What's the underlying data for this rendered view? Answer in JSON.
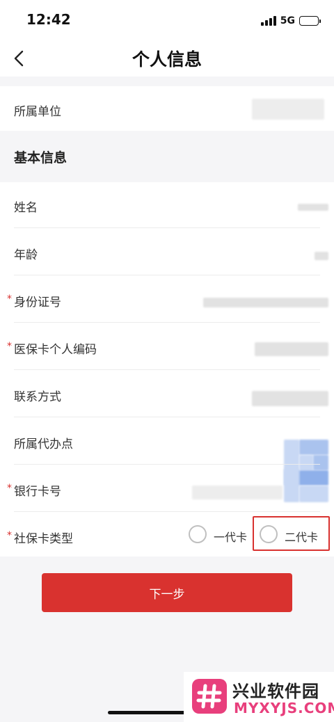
{
  "status_bar": {
    "time": "12:42",
    "network": "5G"
  },
  "nav": {
    "title": "个人信息",
    "back_icon": "chevron-left-icon"
  },
  "unit": {
    "label": "所属单位"
  },
  "basic_info": {
    "section_title": "基本信息",
    "fields": [
      {
        "key": "name",
        "label": "姓名",
        "required": false
      },
      {
        "key": "age",
        "label": "年龄",
        "required": false
      },
      {
        "key": "id_number",
        "label": "身份证号",
        "required": true
      },
      {
        "key": "medical_card",
        "label": "医保卡个人编码",
        "required": true
      },
      {
        "key": "contact",
        "label": "联系方式",
        "required": false
      },
      {
        "key": "agency",
        "label": "所属代办点",
        "required": false
      },
      {
        "key": "bank_card",
        "label": "银行卡号",
        "required": true
      },
      {
        "key": "card_type",
        "label": "社保卡类型",
        "required": true
      }
    ],
    "required_mark": "*"
  },
  "card_type_options": {
    "option_1": "一代卡",
    "option_2": "二代卡"
  },
  "actions": {
    "next_label": "下一步"
  },
  "watermark": {
    "title": "兴业软件园",
    "subtitle": "MYXYJS.COM"
  },
  "colors": {
    "accent": "#d9322f",
    "background": "#f5f5f7",
    "watermark_pink": "#e83f7c"
  }
}
